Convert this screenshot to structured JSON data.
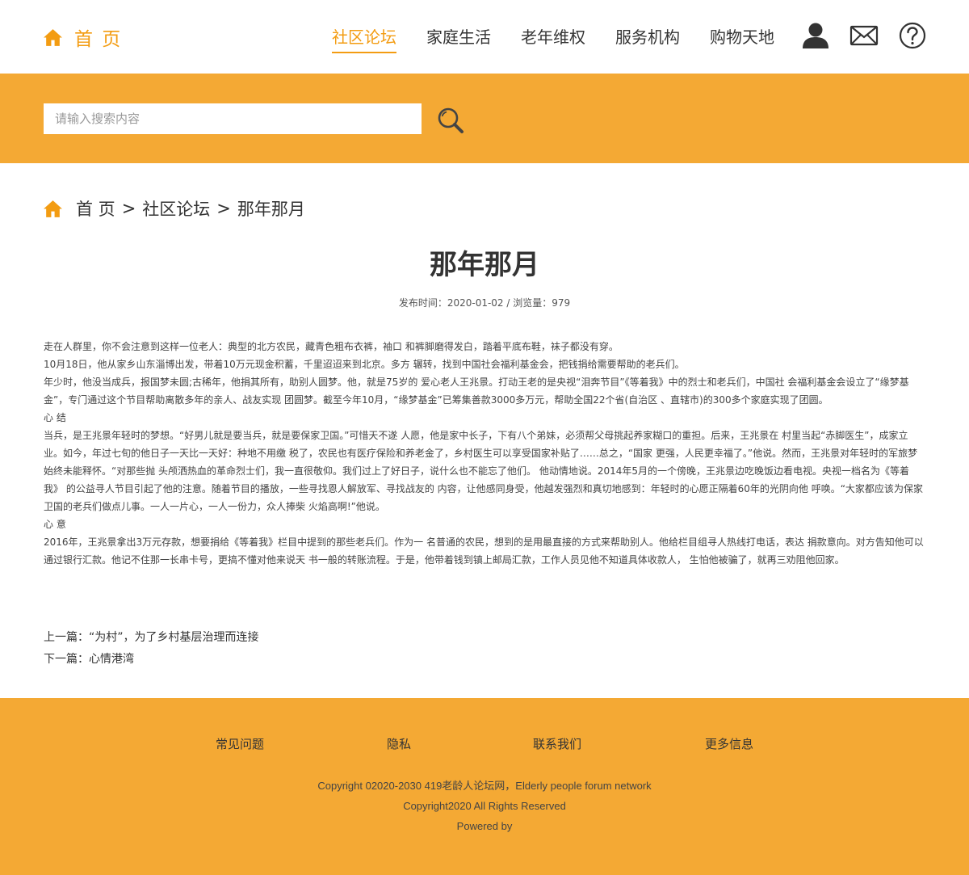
{
  "colors": {
    "accent": "#f39c12",
    "band": "#f4a934",
    "text": "#333333"
  },
  "header": {
    "brand_icon": "home-icon",
    "brand_label": "首 页",
    "nav": [
      {
        "label": "社区论坛",
        "active": true
      },
      {
        "label": "家庭生活"
      },
      {
        "label": "老年维权"
      },
      {
        "label": "服务机构"
      },
      {
        "label": "购物天地"
      }
    ],
    "icons": [
      "user-icon",
      "mail-icon",
      "help-icon"
    ]
  },
  "search": {
    "placeholder": "请输入搜索内容",
    "value": "",
    "button_icon": "search-icon"
  },
  "breadcrumb": {
    "icon": "home-icon",
    "home": "首 页",
    "sep": ">",
    "section": "社区论坛",
    "current": "那年那月"
  },
  "article": {
    "title": "那年那月",
    "meta": "发布时间：2020-01-02 / 浏览量：979",
    "paragraphs": [
      "走在人群里，你不会注意到这样一位老人：典型的北方农民，藏青色粗布衣裤，袖口 和裤脚磨得发白，踏着平底布鞋，袜子都没有穿。",
      "10月18日，他从家乡山东淄博出发，带着10万元现金积蓄，千里迢迢来到北京。多方 辗转，找到中国社会福利基金会，把钱捐给需要帮助的老兵们。",
      "年少时，他没当成兵，报国梦未圆;古稀年，他捐其所有，助别人圆梦。他，就是75岁的 爱心老人王兆景。打动王老的是央视“泪奔节目”《等着我》中的烈士和老兵们，中国社 会福利基金会设立了“缘梦基金”，专门通过这个节目帮助离散多年的亲人、战友实现 团圆梦。截至今年10月，“缘梦基金”已筹集善款3000多万元，帮助全国22个省(自治区 、直辖市)的300多个家庭实现了团圆。",
      "心 结",
      "当兵，是王兆景年轻时的梦想。“好男儿就是要当兵，就是要保家卫国。”可惜天不遂 人愿，他是家中长子，下有八个弟妹，必须帮父母挑起养家糊口的重担。后来，王兆景在 村里当起“赤脚医生”，成家立业。如今，年过七旬的他日子一天比一天好：种地不用缴 税了，农民也有医疗保险和养老金了，乡村医生可以享受国家补贴了……总之，“国家 更强，人民更幸福了。”他说。然而，王兆景对年轻时的军旅梦始终未能释怀。“对那些抛 头颅洒热血的革命烈士们，我一直很敬仰。我们过上了好日子，说什么也不能忘了他们。 他动情地说。2014年5月的一个傍晚，王兆景边吃晚饭边看电视。央视一档名为《等着我》 的公益寻人节目引起了他的注意。随着节目的播放，一些寻找恩人解放军、寻找战友的 内容，让他感同身受，他越发强烈和真切地感到：年轻时的心愿正隔着60年的光阴向他 呼唤。“大家都应该为保家卫国的老兵们做点儿事。一人一片心，一人一份力，众人捧柴 火焰高啊!”他说。",
      "心 意",
      "2016年，王兆景拿出3万元存款，想要捐给《等着我》栏目中提到的那些老兵们。作为一 名普通的农民，想到的是用最直接的方式来帮助别人。他给栏目组寻人热线打电话，表达 捐款意向。对方告知他可以通过银行汇款。他记不住那一长串卡号，更搞不懂对他来说天 书一般的转账流程。于是，他带着钱到镇上邮局汇款，工作人员见他不知道具体收款人， 生怕他被骗了，就再三劝阻他回家。"
    ],
    "prev": "上一篇：“为村”，为了乡村基层治理而连接",
    "next": "下一篇：心情港湾"
  },
  "footer": {
    "links": [
      "常见问题",
      "隐私",
      "联系我们",
      "更多信息"
    ],
    "copyright1": "Copyright 02020-2030 419老龄人论坛网，Elderly people forum network",
    "copyright2": "Copyright2020 All Rights Reserved",
    "powered": "Powered by"
  }
}
